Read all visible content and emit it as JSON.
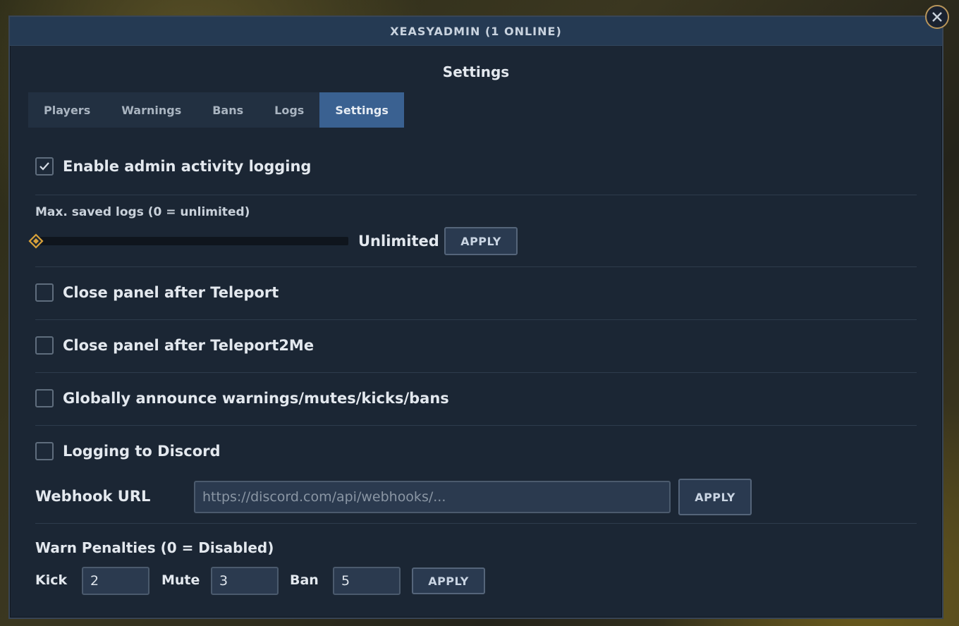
{
  "window": {
    "title": "XEASYADMIN (1 ONLINE)"
  },
  "page": {
    "title": "Settings"
  },
  "tabs": [
    {
      "label": "Players"
    },
    {
      "label": "Warnings"
    },
    {
      "label": "Bans"
    },
    {
      "label": "Logs"
    },
    {
      "label": "Settings",
      "active": true
    }
  ],
  "settings": {
    "admin_logging": {
      "label": "Enable admin activity logging",
      "checked": true
    },
    "max_logs": {
      "label": "Max. saved logs (0 = unlimited)",
      "value_text": "Unlimited",
      "value": 0,
      "apply_label": "APPLY"
    },
    "close_after_teleport": {
      "label": "Close panel after Teleport",
      "checked": false
    },
    "close_after_teleport2me": {
      "label": "Close panel after Teleport2Me",
      "checked": false
    },
    "global_announce": {
      "label": "Globally announce warnings/mutes/kicks/bans",
      "checked": false
    },
    "discord_logging": {
      "label": "Logging to Discord",
      "checked": false
    },
    "webhook": {
      "label": "Webhook URL",
      "placeholder": "https://discord.com/api/webhooks/...",
      "value": "",
      "apply_label": "APPLY"
    },
    "warn_penalties": {
      "label": "Warn Penalties (0 = Disabled)",
      "kick_label": "Kick",
      "kick_value": "2",
      "mute_label": "Mute",
      "mute_value": "3",
      "ban_label": "Ban",
      "ban_value": "5",
      "apply_label": "APPLY"
    }
  },
  "colors": {
    "accent": "#3a6191",
    "panel": "#1b2634",
    "titlebar": "#253a53",
    "slider_thumb": "#d9a23a",
    "close_border": "#b8955a"
  }
}
